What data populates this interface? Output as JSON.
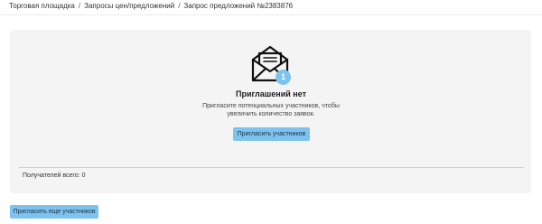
{
  "breadcrumb": {
    "items": [
      "Торговая площадка",
      "Запросы цен/предложений",
      "Запрос предложений №2383876"
    ],
    "separator": "/"
  },
  "empty_state": {
    "icon": "envelope-icon",
    "badge_count": "1",
    "title": "Приглашений нет",
    "description": "Пригласите потенциальных участников, чтобы увеличить количество заявок.",
    "invite_button": "Пригласить участников"
  },
  "footer": {
    "recipients_label": "Получателей всего: 0"
  },
  "invite_more_button": "Пригласить еще участников",
  "colors": {
    "accent": "#7ec3f0",
    "card_background": "#f4f4f4"
  }
}
